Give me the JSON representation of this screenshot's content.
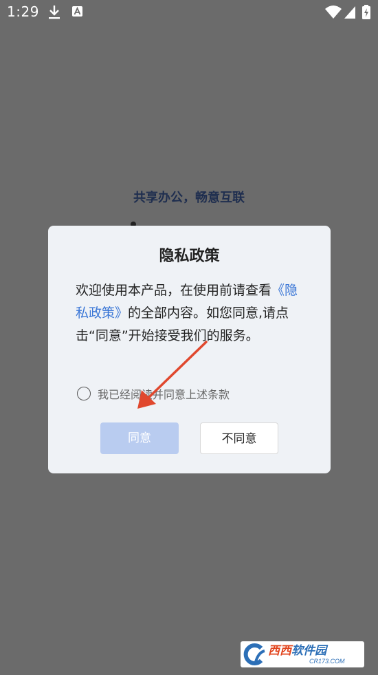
{
  "status_bar": {
    "time": "1:29",
    "icons": [
      "download-icon",
      "a-notification-icon",
      "wifi-icon",
      "signal-icon",
      "battery-icon"
    ]
  },
  "background": {
    "slogan": "共享办公，畅意互联"
  },
  "dialog": {
    "title": "隐私政策",
    "body_prefix": "欢迎使用本产品，在使用前请查看",
    "policy_link": "《隐私政策》",
    "body_suffix": "的全部内容。如您同意,请点击“同意”开始接受我们的服务。",
    "agree_checkbox_label": "我已经阅读并同意上述条款",
    "agree_button": "同意",
    "disagree_button": "不同意"
  },
  "watermark": {
    "main_a": "西西",
    "main_b": "软件园",
    "sub": "CR173.COM"
  },
  "colors": {
    "overlay_bg": "#6b6b6b",
    "dialog_bg": "#eff2f6",
    "link": "#3a76d6",
    "agree_button_bg": "#b9ccf0",
    "slogan": "#1f2e4f",
    "arrow": "#e0482e"
  }
}
